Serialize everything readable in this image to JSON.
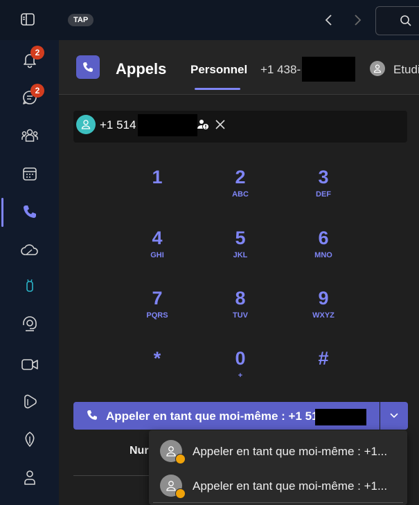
{
  "topbar": {
    "badge": "TAP",
    "icons": [
      "sidebar-toggle-icon",
      "back-arrow-icon",
      "forward-arrow-icon",
      "search-icon"
    ]
  },
  "rail": {
    "items": [
      {
        "icon": "bell-icon",
        "badge": "2"
      },
      {
        "icon": "chat-icon",
        "badge": "2"
      },
      {
        "icon": "teams-icon"
      },
      {
        "icon": "calendar-icon"
      },
      {
        "icon": "phone-icon",
        "active": true
      },
      {
        "icon": "onedrive-icon"
      },
      {
        "icon": "app-icon"
      },
      {
        "icon": "copilot-headset-icon"
      },
      {
        "icon": "video-icon"
      },
      {
        "icon": "microsoft365-icon"
      },
      {
        "icon": "viva-icon"
      },
      {
        "icon": "person-icon"
      }
    ]
  },
  "header": {
    "title": "Appels",
    "tabs": [
      {
        "label": "Personnel",
        "active": true
      },
      {
        "label": "+1 438-"
      }
    ],
    "user_name": "Etudi"
  },
  "number_field": {
    "value": "+1 514"
  },
  "dialpad": {
    "keys": [
      {
        "digit": "1",
        "letters": ""
      },
      {
        "digit": "2",
        "letters": "ABC"
      },
      {
        "digit": "3",
        "letters": "DEF"
      },
      {
        "digit": "4",
        "letters": "GHI"
      },
      {
        "digit": "5",
        "letters": "JKL"
      },
      {
        "digit": "6",
        "letters": "MNO"
      },
      {
        "digit": "7",
        "letters": "PQRS"
      },
      {
        "digit": "8",
        "letters": "TUV"
      },
      {
        "digit": "9",
        "letters": "WXYZ"
      },
      {
        "digit": "*",
        "letters": ""
      },
      {
        "digit": "0",
        "letters": "+"
      },
      {
        "digit": "#",
        "letters": ""
      }
    ]
  },
  "call_button": {
    "label": "Appeler en tant que moi-même : +1 51"
  },
  "under_text": "Nur",
  "menu": {
    "items": [
      {
        "label": "Appeler en tant que moi-même : +1..."
      },
      {
        "label": "Appeler en tant que moi-même : +1..."
      }
    ]
  },
  "colors": {
    "accent": "#5b5fc7",
    "accent_text": "#7f85f5",
    "badge": "#d33d1f",
    "rail": "#111a2b",
    "content": "#1f1f1f"
  }
}
